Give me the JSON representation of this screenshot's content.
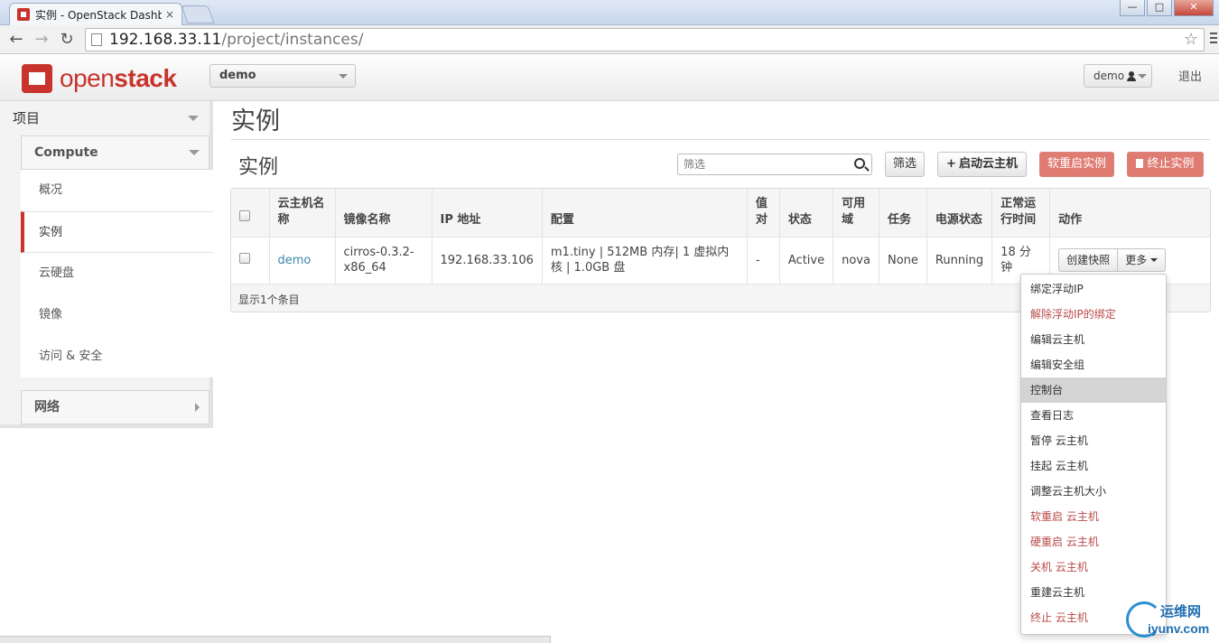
{
  "browser": {
    "tab_title": "实例 - OpenStack Dashboard",
    "tab_close": "×",
    "url_host": "192.168.33.11",
    "url_path": "/project/instances/",
    "back": "←",
    "forward": "→",
    "reload": "↻",
    "star": "☆",
    "win_min": "—",
    "win_max": "□",
    "win_close": "✕"
  },
  "header": {
    "logo_prefix": "open",
    "logo_suffix": "stack",
    "project": "demo",
    "user": "demo",
    "logout": "退出"
  },
  "sidebar": {
    "section": "项目",
    "group_compute": "Compute",
    "items": [
      "概况",
      "实例",
      "云硬盘",
      "镜像",
      "访问 & 安全"
    ],
    "group_network": "网络"
  },
  "page": {
    "title": "实例",
    "table_title": "实例",
    "filter_placeholder": "筛选",
    "filter_button": "筛选",
    "launch_button": "启动云主机",
    "soft_reboot_button": "软重启实例",
    "terminate_button": "终止实例"
  },
  "table": {
    "headers": [
      "云主机名称",
      "镜像名称",
      "IP 地址",
      "配置",
      "值对",
      "状态",
      "可用域",
      "任务",
      "电源状态",
      "正常运行时间",
      "动作"
    ],
    "rows": [
      {
        "name": "demo",
        "image": "cirros-0.3.2-x86_64",
        "ip": "192.168.33.106",
        "flavor": "m1.tiny | 512MB 内存| 1 虚拟内核 | 1.0GB 盘",
        "keypair": "-",
        "status": "Active",
        "zone": "nova",
        "task": "None",
        "power": "Running",
        "uptime": "18 分钟",
        "action_primary": "创建快照",
        "action_more": "更多"
      }
    ],
    "footer": "显示1个条目"
  },
  "dropdown": {
    "items": [
      {
        "label": "绑定浮动IP",
        "danger": false
      },
      {
        "label": "解除浮动IP的绑定",
        "danger": true
      },
      {
        "label": "编辑云主机",
        "danger": false
      },
      {
        "label": "编辑安全组",
        "danger": false
      },
      {
        "label": "控制台",
        "danger": false
      },
      {
        "label": "查看日志",
        "danger": false
      },
      {
        "label": "暂停 云主机",
        "danger": false
      },
      {
        "label": "挂起 云主机",
        "danger": false
      },
      {
        "label": "调整云主机大小",
        "danger": false
      },
      {
        "label": "软重启 云主机",
        "danger": true
      },
      {
        "label": "硬重启 云主机",
        "danger": true
      },
      {
        "label": "关机 云主机",
        "danger": true
      },
      {
        "label": "重建云主机",
        "danger": false
      },
      {
        "label": "终止 云主机",
        "danger": true
      }
    ],
    "hovered_index": 4
  },
  "watermark": {
    "line1": "运维网",
    "line2": "iyunv.com"
  },
  "colors": {
    "brand": "#c8332b",
    "danger_text": "#b94a48",
    "danger_button": "#e07b72",
    "link": "#3a87ad"
  }
}
